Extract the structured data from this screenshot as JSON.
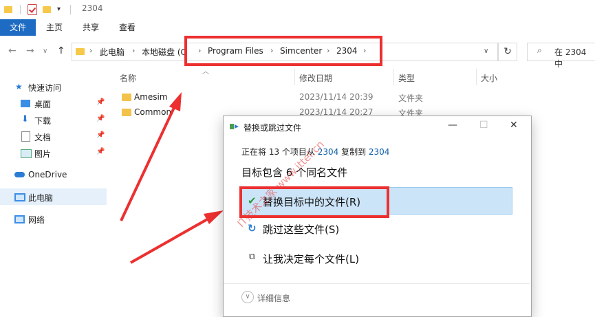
{
  "window": {
    "title": "2304"
  },
  "ribbon": {
    "tabs": [
      "文件",
      "主页",
      "共享",
      "查看"
    ]
  },
  "address": {
    "crumbs": [
      "此电脑",
      "本地磁盘 (C",
      "Program Files",
      "Simcenter",
      "2304"
    ],
    "search_placeholder": "在 2304 中"
  },
  "nav_pane": {
    "items": [
      {
        "label": "快速访问",
        "icon": "star-icon"
      },
      {
        "label": "桌面",
        "icon": "desktop-icon",
        "pinned": true
      },
      {
        "label": "下载",
        "icon": "download-icon",
        "pinned": true
      },
      {
        "label": "文档",
        "icon": "document-icon",
        "pinned": true
      },
      {
        "label": "图片",
        "icon": "picture-icon",
        "pinned": true
      },
      {
        "label": "OneDrive",
        "icon": "cloud-icon"
      },
      {
        "label": "此电脑",
        "icon": "pc-icon",
        "selected": true
      },
      {
        "label": "网络",
        "icon": "network-icon"
      }
    ]
  },
  "file_list": {
    "headers": [
      "名称",
      "修改日期",
      "类型",
      "大小"
    ],
    "rows": [
      {
        "name": "Amesim",
        "modified": "2023/11/14 20:39",
        "type": "文件夹"
      },
      {
        "name": "Common",
        "modified": "2023/11/14 20:27",
        "type": "文件夹"
      }
    ]
  },
  "dialog": {
    "title": "替换或跳过文件",
    "status_prefix": "正在将 13 个项目从 ",
    "status_source": "2304",
    "status_middle": " 复制到 ",
    "status_target": "2304",
    "conflict_text": "目标包含 6 个同名文件",
    "options": [
      "替换目标中的文件(R)",
      "跳过这些文件(S)",
      "让我决定每个文件(L)"
    ],
    "details_label": "详细信息"
  },
  "watermark": "IT技术之家 www.ittel.cn",
  "colors": {
    "accent": "#1e6bc4",
    "annotation": "#ec3030",
    "highlight": "#cce4f7"
  }
}
